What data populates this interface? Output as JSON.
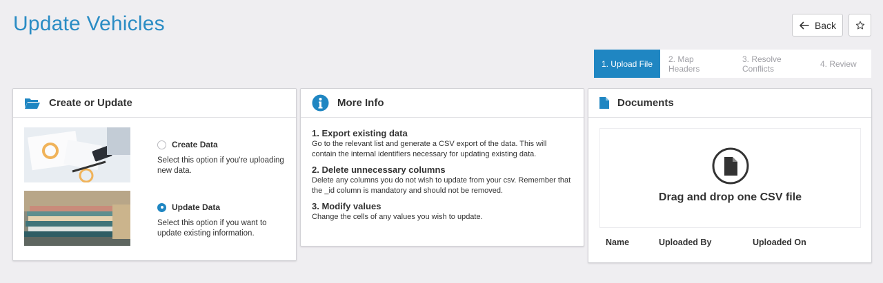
{
  "header": {
    "title": "Update Vehicles",
    "back_label": "Back"
  },
  "stepper": {
    "steps": [
      "1. Upload File",
      "2. Map Headers",
      "3. Resolve Conflicts",
      "4. Review"
    ],
    "active_index": 0
  },
  "create_update": {
    "title": "Create or Update",
    "options": [
      {
        "label": "Create Data",
        "description": "Select this option if you're uploading new data.",
        "selected": false
      },
      {
        "label": "Update Data",
        "description": "Select this option if you want to update existing information.",
        "selected": true
      }
    ]
  },
  "more_info": {
    "title": "More Info",
    "items": [
      {
        "heading": "1. Export existing data",
        "text": "Go to the relevant list and generate a CSV export of the data. This will contain the internal identifiers necessary for updating existing data."
      },
      {
        "heading": "2. Delete unnecessary columns",
        "text": "Delete any columns you do not wish to update from your csv. Remember that the _id column is mandatory and should not be removed."
      },
      {
        "heading": "3. Modify values",
        "text": "Change the cells of any values you wish to update."
      }
    ]
  },
  "documents": {
    "title": "Documents",
    "dropzone_text": "Drag and drop one CSV file",
    "columns": [
      "Name",
      "Uploaded By",
      "Uploaded On"
    ]
  },
  "colors": {
    "accent": "#1f86c2",
    "title": "#2a8cc4",
    "background": "#efeef1"
  },
  "icons": {
    "back": "arrow-left-icon",
    "favorite": "star-icon",
    "create_update": "folder-open-icon",
    "more_info": "info-circle-icon",
    "documents": "file-icon",
    "dropzone": "file-circle-icon"
  }
}
